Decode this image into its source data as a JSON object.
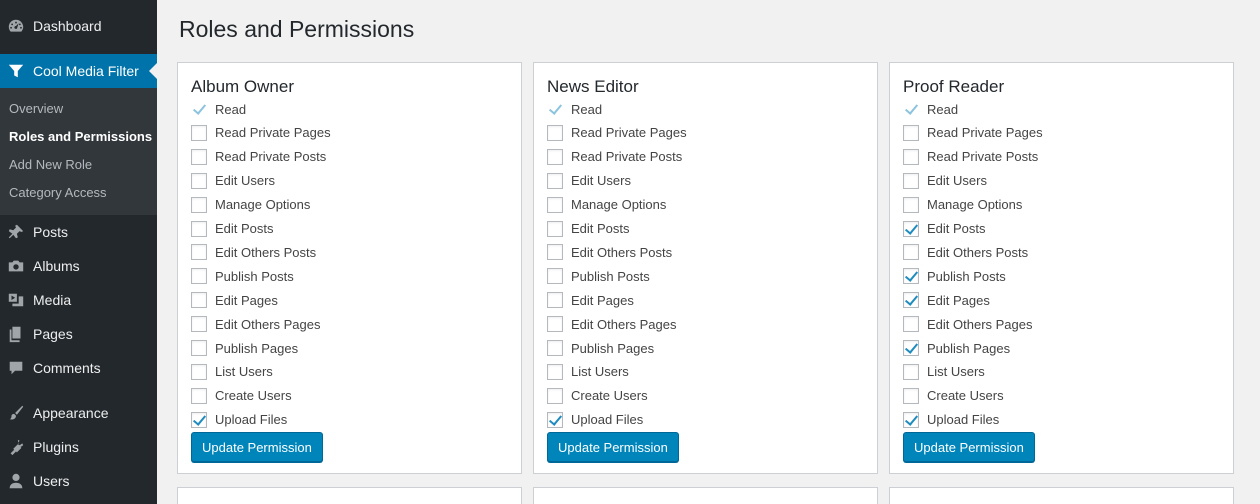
{
  "sidebar": {
    "items": [
      {
        "label": "Dashboard",
        "icon": "dashboard-icon"
      },
      {
        "label": "Cool Media Filter",
        "icon": "filter-icon"
      },
      {
        "label": "Posts",
        "icon": "pin-icon"
      },
      {
        "label": "Albums",
        "icon": "camera-icon"
      },
      {
        "label": "Media",
        "icon": "media-icon"
      },
      {
        "label": "Pages",
        "icon": "pages-icon"
      },
      {
        "label": "Comments",
        "icon": "comment-icon"
      },
      {
        "label": "Appearance",
        "icon": "brush-icon"
      },
      {
        "label": "Plugins",
        "icon": "plug-icon"
      },
      {
        "label": "Users",
        "icon": "user-icon"
      }
    ],
    "submenu": [
      "Overview",
      "Roles and Permissions",
      "Add New Role",
      "Category Access"
    ]
  },
  "page": {
    "title": "Roles and Permissions"
  },
  "permission_labels": [
    "Read",
    "Read Private Pages",
    "Read Private Posts",
    "Edit Users",
    "Manage Options",
    "Edit Posts",
    "Edit Others Posts",
    "Publish Posts",
    "Edit Pages",
    "Edit Others Pages",
    "Publish Pages",
    "List Users",
    "Create Users",
    "Upload Files"
  ],
  "roles": [
    {
      "name": "Album Owner",
      "checked": [
        true,
        false,
        false,
        false,
        false,
        false,
        false,
        false,
        false,
        false,
        false,
        false,
        false,
        true
      ],
      "button": "Update Permission"
    },
    {
      "name": "News Editor",
      "checked": [
        true,
        false,
        false,
        false,
        false,
        false,
        false,
        false,
        false,
        false,
        false,
        false,
        false,
        true
      ],
      "button": "Update Permission"
    },
    {
      "name": "Proof Reader",
      "checked": [
        true,
        false,
        false,
        false,
        false,
        true,
        false,
        true,
        true,
        false,
        true,
        false,
        false,
        true
      ],
      "button": "Update Permission"
    }
  ],
  "colors": {
    "accent": "#0073aa",
    "sidebar": "#23282d",
    "button": "#0085ba"
  }
}
